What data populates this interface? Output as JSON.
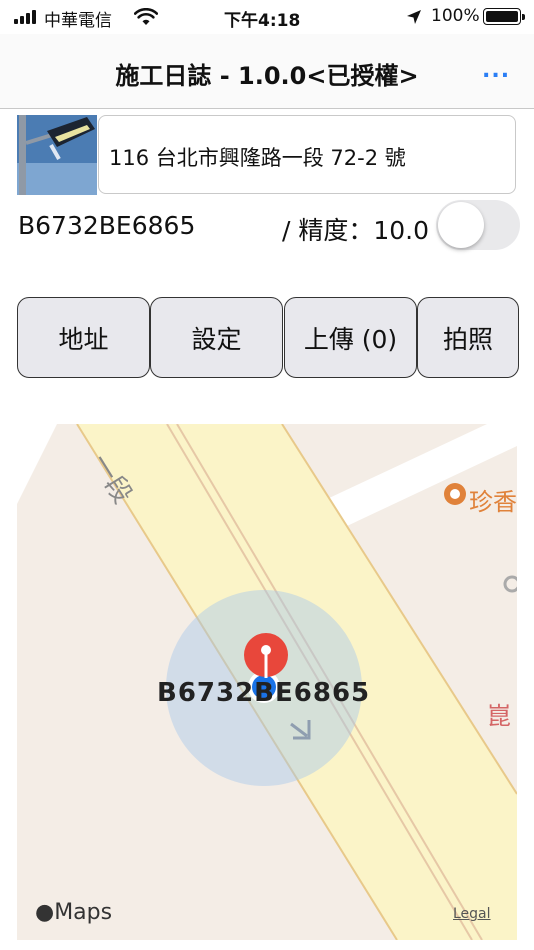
{
  "status_bar": {
    "carrier": "中華電信",
    "time": "下午4:18",
    "battery": "100%"
  },
  "nav": {
    "title": "施工日誌 - 1.0.0<已授權>",
    "more": "..."
  },
  "address": {
    "value": "116 台北市興隆路一段 72-2 號"
  },
  "device": {
    "code": "B6732BE6865",
    "precision_label": "/ 精度：10.0",
    "toggle_on": false
  },
  "buttons": {
    "address": "地址",
    "settings": "設定",
    "upload": "上傳 (0)",
    "photo": "拍照"
  },
  "map": {
    "pin_label": "B6732BE6865",
    "road_label": "一段",
    "poi_label": "珍香",
    "poi_label2": "崑",
    "provider": "Maps",
    "legal": "Legal",
    "colors": {
      "road_fill": "#fbf4c8",
      "road_edge": "#e8c98a",
      "accuracy_circle": "#a7c7ec",
      "pin": "#e8473b",
      "user_dot": "#1a73e8",
      "poi": "#e0823a"
    }
  }
}
